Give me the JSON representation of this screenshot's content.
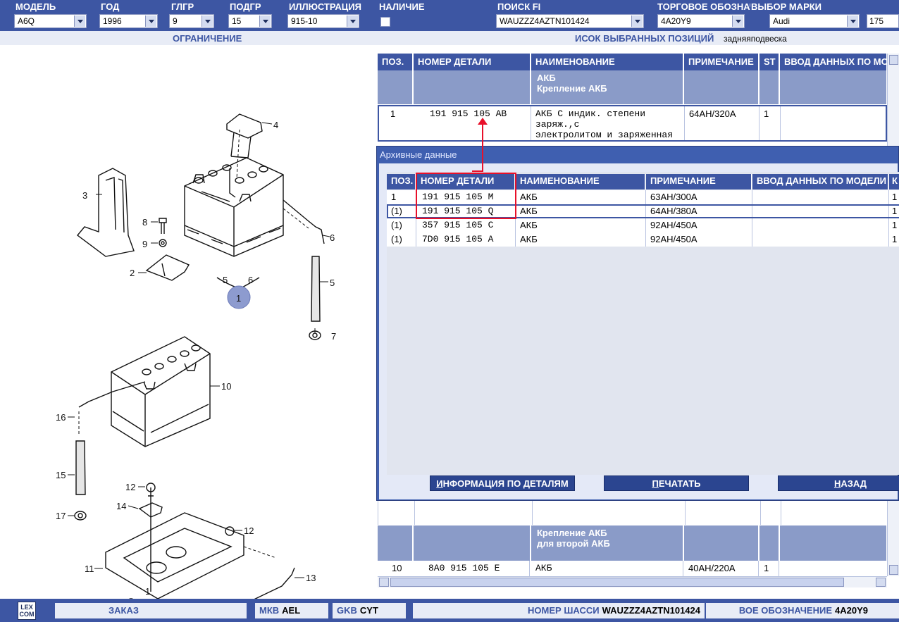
{
  "filters": [
    {
      "label": "МОДЕЛЬ",
      "value": "A6Q"
    },
    {
      "label": "ГОД",
      "value": "1996"
    },
    {
      "label": "ГЛГР",
      "value": "9"
    },
    {
      "label": "ПОДГР",
      "value": "15"
    },
    {
      "label": "ИЛЛЮСТРАЦИЯ",
      "value": "915-10"
    },
    {
      "label": "НАЛИЧИЕ",
      "value": ""
    },
    {
      "label": "ПОИСК FI",
      "value": "WAUZZZ4AZTN101424"
    },
    {
      "label": "ТОРГОВОЕ ОБОЗНАЧЕНИ",
      "value": "4A20Y9"
    },
    {
      "label": "ВЫБОР МАРКИ",
      "value": "Audi"
    },
    {
      "label": "",
      "value": "175"
    }
  ],
  "subbar": {
    "restriction": "ОГРАНИЧЕНИЕ",
    "selected_list_label": "ИСОК ВЫБРАННЫХ ПОЗИЦИЙ",
    "selected_list_value": "задняяподвеска"
  },
  "illustration": {
    "callouts": [
      "4",
      "3",
      "8",
      "9",
      "2",
      "5",
      "6",
      "1",
      "6",
      "5",
      "7",
      "10",
      "16",
      "15",
      "17",
      "12",
      "14",
      "12",
      "11",
      "13",
      "12",
      "1"
    ]
  },
  "parts_table": {
    "headers": [
      "ПОЗ.",
      "НОМЕР ДЕТАЛИ",
      "НАИМЕНОВАНИЕ",
      "ПРИМЕЧАНИЕ",
      "ST",
      "ВВОД ДАННЫХ ПО МО"
    ],
    "group1": [
      "АКБ",
      "Крепление АКБ"
    ],
    "row1": {
      "pos": "1",
      "part": "191 915 105 AB",
      "name_line1": "АКБ С индик. степени заряж.,с",
      "name_line2": "электролитом и заряженная",
      "note": "64AH/320A",
      "st": "1"
    },
    "group2": [
      "Крепление АКБ",
      "для второй АКБ"
    ],
    "row10": {
      "pos": "10",
      "part": "8A0 915 105 E",
      "name": "АКБ",
      "note": "40AH/220A",
      "st": "1"
    }
  },
  "archive_dialog": {
    "title": "Архивные данные",
    "headers": [
      "ПОЗ.",
      "НОМЕР ДЕТАЛИ",
      "НАИМЕНОВАНИЕ",
      "ПРИМЕЧАНИЕ",
      "ВВОД ДАННЫХ ПО МОДЕЛИ",
      "К"
    ],
    "rows": [
      {
        "pos": "1",
        "part": "191 915 105 M",
        "name": "АКБ",
        "note": "63AH/300A",
        "model": "",
        "k": "1"
      },
      {
        "pos": "(1)",
        "part": "191 915 105 Q",
        "name": "АКБ",
        "note": "64AH/380A",
        "model": "",
        "k": "1"
      },
      {
        "pos": "(1)",
        "part": "357 915 105 C",
        "name": "АКБ",
        "note": "92AH/450A",
        "model": "",
        "k": "1"
      },
      {
        "pos": "(1)",
        "part": "7D0 915 105 A",
        "name": "АКБ",
        "note": "92AH/450A",
        "model": "",
        "k": "1"
      }
    ],
    "buttons": [
      {
        "accel": "И",
        "rest": "НФОРМАЦИЯ ПО ДЕТАЛЯМ"
      },
      {
        "accel": "П",
        "rest": "ЕЧАТАТЬ"
      },
      {
        "accel": "Н",
        "rest": "АЗАД"
      }
    ]
  },
  "statusbar": {
    "logo": "LEX COM",
    "order": "ЗАКАЗ",
    "mkb_label": "МКВ",
    "mkb_value": "AEL",
    "gkb_label": "GKB",
    "gkb_value": "CYT",
    "chassis_label": "НОМЕР ШАССИ",
    "chassis_value": "WAUZZZ4AZTN101424",
    "trade_label": "ВОЕ ОБОЗНАЧЕНИЕ",
    "trade_value": "4A20Y9"
  },
  "colors": {
    "bar": "#3d56a3",
    "group": "#8a9bc8",
    "highlight": "#e8102a"
  }
}
